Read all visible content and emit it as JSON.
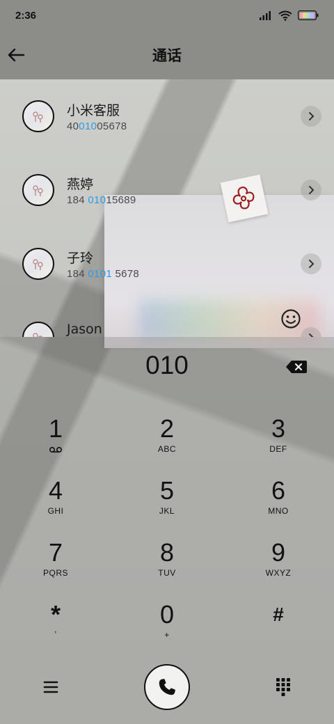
{
  "status_bar": {
    "time": "2:36",
    "icons": [
      "signal-icon",
      "wifi-icon",
      "battery-icon"
    ]
  },
  "header": {
    "title": "通话",
    "back_icon": "back-arrow-icon"
  },
  "contacts": [
    {
      "name": "小米客服",
      "number_pre": "40",
      "number_match": "010",
      "number_post": "05678"
    },
    {
      "name": "燕婷",
      "number_pre": "184 ",
      "number_match": "010",
      "number_post": "15689"
    },
    {
      "name": "子玲",
      "number_pre": "184 ",
      "number_match": "0101",
      "number_post": " 5678"
    },
    {
      "name": "Jason",
      "number_pre": "",
      "number_match": "",
      "number_post": ""
    }
  ],
  "dialer": {
    "input": "010",
    "keys": [
      {
        "digit": "1",
        "letters": ""
      },
      {
        "digit": "2",
        "letters": "ABC"
      },
      {
        "digit": "3",
        "letters": "DEF"
      },
      {
        "digit": "4",
        "letters": "GHI"
      },
      {
        "digit": "5",
        "letters": "JKL"
      },
      {
        "digit": "6",
        "letters": "MNO"
      },
      {
        "digit": "7",
        "letters": "PQRS"
      },
      {
        "digit": "8",
        "letters": "TUV"
      },
      {
        "digit": "9",
        "letters": "WXYZ"
      },
      {
        "digit": "*",
        "letters": ","
      },
      {
        "digit": "0",
        "letters": "+"
      },
      {
        "digit": "#",
        "letters": ""
      }
    ]
  },
  "colors": {
    "highlight": "#2f9be8",
    "bar_bg": "#8c8c88"
  }
}
